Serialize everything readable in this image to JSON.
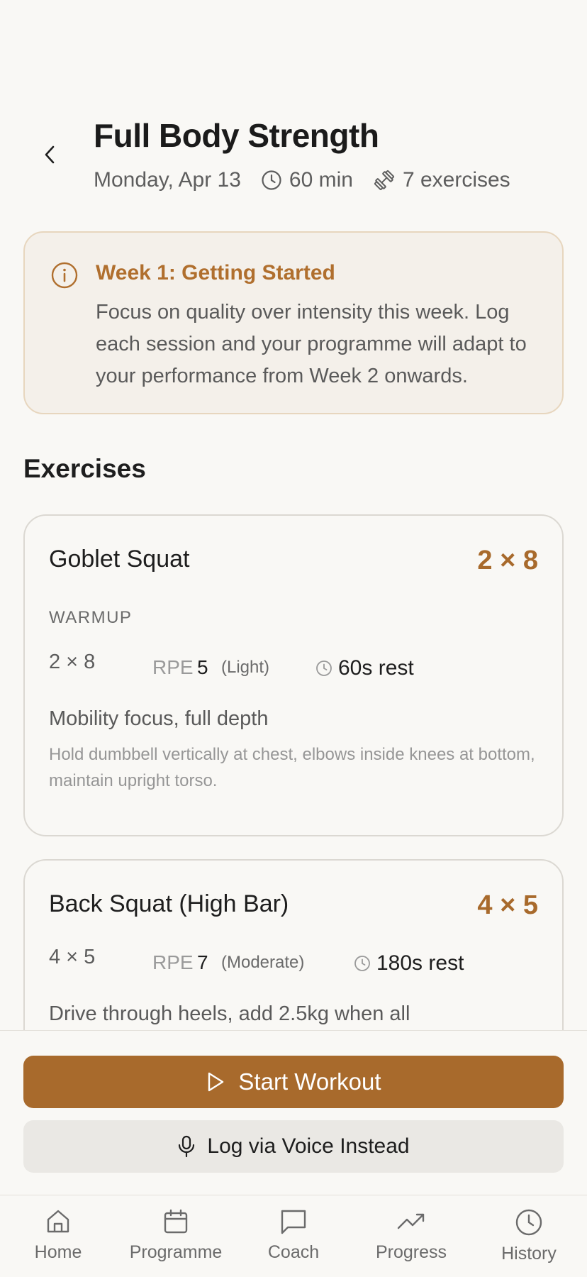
{
  "header": {
    "title": "Full Body Strength",
    "date": "Monday, Apr 13",
    "duration": "60 min",
    "exercise_count": "7 exercises"
  },
  "callout": {
    "title": "Week 1: Getting Started",
    "body": "Focus on quality over intensity this week. Log each session and your programme will adapt to your performance from Week 2 onwards."
  },
  "section_title": "Exercises",
  "exercises": [
    {
      "name": "Goblet Squat",
      "sets_reps": "2 × 8",
      "phase": "WARMUP",
      "rpe_label": "RPE",
      "rpe_value": "5",
      "intensity": "(Light)",
      "rest": "60s rest",
      "cue": "Mobility focus, full depth",
      "description": "Hold dumbbell vertically at chest, elbows inside knees at bottom, maintain upright torso."
    },
    {
      "name": "Back Squat (High Bar)",
      "sets_reps": "4 × 5",
      "rpe_label": "RPE",
      "rpe_value": "7",
      "intensity": "(Moderate)",
      "rest": "180s rest",
      "cue": "Drive through heels, add 2.5kg when all"
    }
  ],
  "actions": {
    "start": "Start Workout",
    "voice": "Log via Voice Instead"
  },
  "tabs": [
    {
      "label": "Home",
      "icon": "home-icon"
    },
    {
      "label": "Programme",
      "icon": "calendar-icon"
    },
    {
      "label": "Coach",
      "icon": "chat-icon"
    },
    {
      "label": "Progress",
      "icon": "trend-icon"
    },
    {
      "label": "History",
      "icon": "clock-icon"
    }
  ],
  "colors": {
    "accent": "#A86A2C",
    "background": "#F9F8F5",
    "callout_bg": "#F4F0EA"
  }
}
